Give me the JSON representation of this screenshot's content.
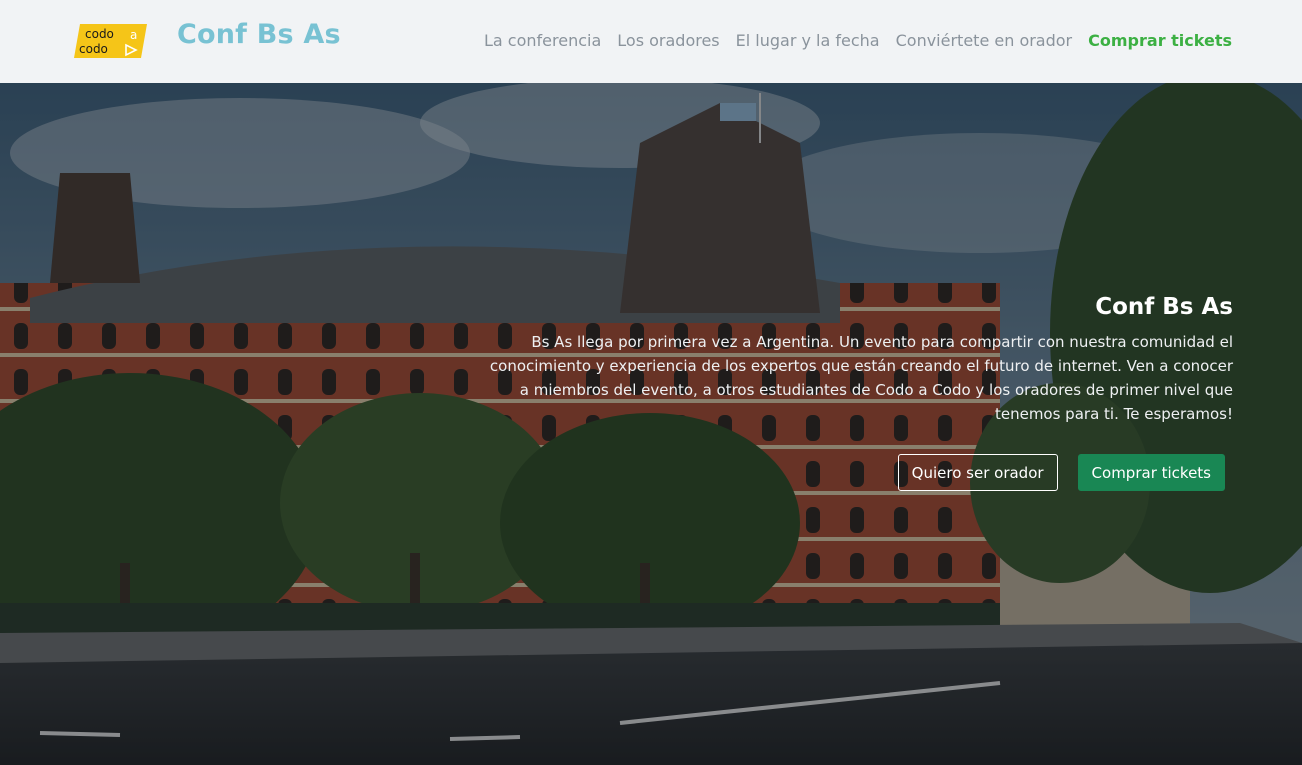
{
  "header": {
    "logo": {
      "line1": "codo",
      "line2": "codo",
      "mark": "a",
      "bg_color": "#f5c518"
    },
    "brand": "Conf Bs As",
    "nav": [
      {
        "label": "La conferencia"
      },
      {
        "label": "Los oradores"
      },
      {
        "label": "El lugar y la fecha"
      },
      {
        "label": "Conviértete en orador"
      },
      {
        "label": "Comprar tickets"
      }
    ]
  },
  "hero": {
    "title": "Conf Bs As",
    "description": "Bs As llega por primera vez a Argentina. Un evento para compartir con nuestra comunidad el conocimiento y experiencia de los expertos que están creando el futuro de internet. Ven a conocer a miembros del evento, a otros estudiantes de Codo a Codo y los oradores de primer nivel que tenemos para ti. Te esperamos!",
    "buttons": {
      "speaker": "Quiero ser orador",
      "tickets": "Comprar tickets"
    },
    "background": "building-street-photo"
  },
  "colors": {
    "brand": "#78c2d3",
    "nav_text": "#8a939c",
    "nav_cta": "#3cb043",
    "button_green": "#198754",
    "navbar_bg": "#f1f3f5"
  }
}
